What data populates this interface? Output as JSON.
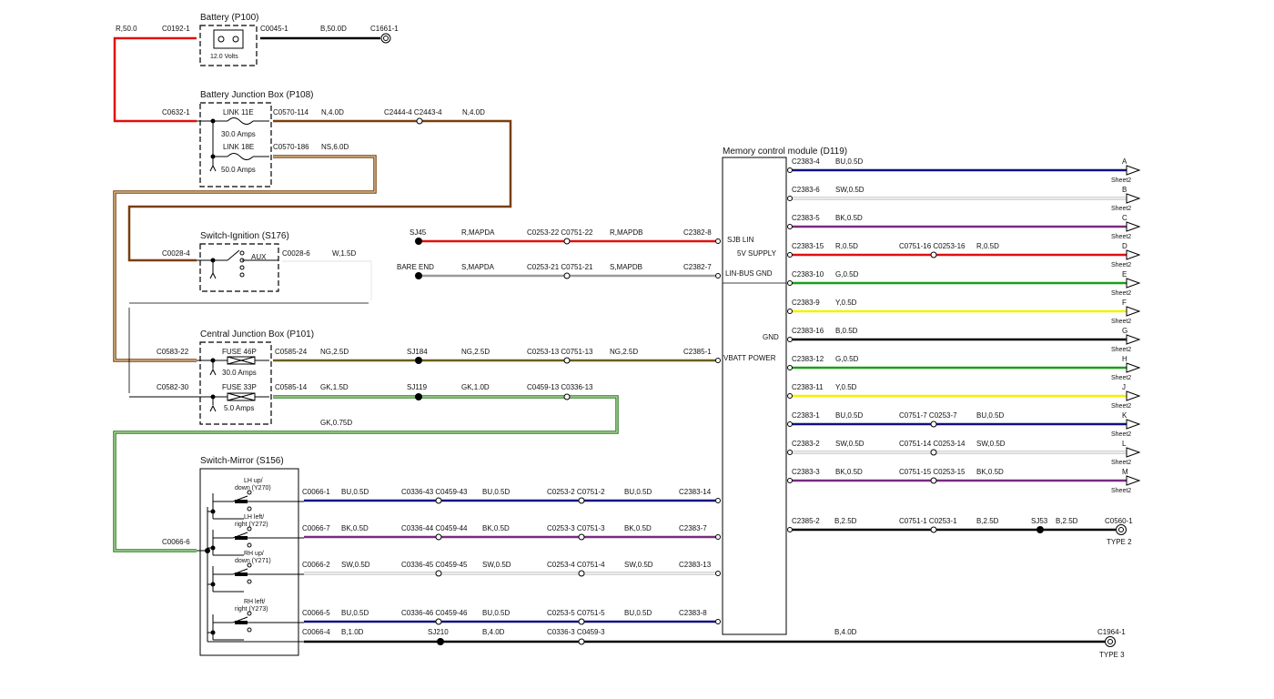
{
  "colors": {
    "red": "#e01010",
    "black": "#000000",
    "brown": "#7a3f0c",
    "blue": "#101080",
    "white": "#c4c4c4",
    "green": "#18a018",
    "yellow": "#f4f000",
    "olive": "#6a5f1a",
    "lightgreen": "#5cae46",
    "violet": "#7a2a80",
    "tan": "#c8a070",
    "grey": "#9a9a9a"
  },
  "battery": {
    "title": "Battery (P100)",
    "voltage": "12.0 Volts",
    "left_connector": "C0192-1",
    "left_wire": "R,50.0",
    "right_connector": "C0045-1",
    "right_wire": "B,50.0D",
    "ground": "C1661-1"
  },
  "bjb": {
    "title": "Battery Junction Box (P108)",
    "in_connector": "C0632-1",
    "link1_name": "LINK 11E",
    "link1_amps": "30.0 Amps",
    "link1_connector": "C0570-114",
    "link1_wire": "N,4.0D",
    "inline_connectors": "C2444-4 C2443-4",
    "inline_wire": "N,4.0D",
    "link2_name": "LINK 18E",
    "link2_amps": "50.0 Amps",
    "link2_connector": "C0570-186",
    "link2_wire": "NS,6.0D"
  },
  "ignition": {
    "title": "Switch-Ignition (S176)",
    "in_connector": "C0028-4",
    "pos_label": "AUX",
    "out_connector": "C0028-6",
    "out_wire": "W,1.5D"
  },
  "cjb": {
    "title": "Central Junction Box (P101)",
    "in1_connector": "C0583-22",
    "fuse1_name": "FUSE 46P",
    "fuse1_amps": "30.0 Amps",
    "out1_connector": "C0585-24",
    "out1_wire": "NG,2.5D",
    "in2_connector": "C0582-30",
    "fuse2_name": "FUSE 33P",
    "fuse2_amps": "5.0 Amps",
    "out2_connector": "C0585-14",
    "out2_wire": "GK,1.5D"
  },
  "middle": {
    "sj45": "SJ45",
    "sj45_wire": "R,MAPDA",
    "sj45_inline": "C0253-22 C0751-22",
    "sj45_wire2": "R,MAPDB",
    "sj45_end": "C2382-8",
    "bare_end": "BARE END",
    "bare_wire": "S,MAPDA",
    "bare_inline": "C0253-21 C0751-21",
    "bare_wire2": "S,MAPDB",
    "bare_end_conn": "C2382-7",
    "sj184": "SJ184",
    "sj184_wire": "NG,2.5D",
    "sj184_inline": "C0253-13 C0751-13",
    "sj184_wire2": "NG,2.5D",
    "sj184_end": "C2385-1",
    "sj119": "SJ119",
    "sj119_wire": "GK,1.0D",
    "sj119_inline": "C0459-13 C0336-13",
    "gk_return": "GK,0.75D"
  },
  "mirror": {
    "title": "Switch-Mirror (S156)",
    "in_connector": "C0066-6",
    "switches": [
      {
        "l1": "LH up/",
        "l2": "down (Y270)"
      },
      {
        "l1": "LH left/",
        "l2": "right (Y272)"
      },
      {
        "l1": "RH up/",
        "l2": "down (Y271)"
      },
      {
        "l1": "RH left/",
        "l2": "right (Y273)"
      }
    ],
    "wires": [
      {
        "c1": "C0066-1",
        "w1": "BU,0.5D",
        "c2": "C0336-43 C0459-43",
        "w2": "BU,0.5D",
        "c3": "C0253-2 C0751-2",
        "w3": "BU,0.5D",
        "end": "C2383-14"
      },
      {
        "c1": "C0066-7",
        "w1": "BK,0.5D",
        "c2": "C0336-44 C0459-44",
        "w2": "BK,0.5D",
        "c3": "C0253-3 C0751-3",
        "w3": "BK,0.5D",
        "end": "C2383-7"
      },
      {
        "c1": "C0066-2",
        "w1": "SW,0.5D",
        "c2": "C0336-45 C0459-45",
        "w2": "SW,0.5D",
        "c3": "C0253-4 C0751-4",
        "w3": "SW,0.5D",
        "end": "C2383-13"
      },
      {
        "c1": "C0066-5",
        "w1": "BU,0.5D",
        "c2": "C0336-46 C0459-46",
        "w2": "BU,0.5D",
        "c3": "C0253-5 C0751-5",
        "w3": "BU,0.5D",
        "end": "C2383-8"
      }
    ],
    "ground": {
      "c1": "C0066-4",
      "w1": "B,1.0D",
      "sj": "SJ210",
      "w2": "B,4.0D",
      "inline": "C0336-3 C0459-3",
      "w3": "B,4.0D",
      "end": "C1964-1",
      "type": "TYPE 3"
    }
  },
  "module": {
    "title": "Memory control module (D119)",
    "pins": [
      "SJB LIN",
      "5V SUPPLY",
      "LIN-BUS GND",
      "GND",
      "VBATT POWER"
    ]
  },
  "outputs": [
    {
      "conn": "C2383-4",
      "wire": "BU,0.5D",
      "inline": "",
      "wire2": "",
      "letter": "A",
      "sheet": "Sheet2"
    },
    {
      "conn": "C2383-6",
      "wire": "SW,0.5D",
      "inline": "",
      "wire2": "",
      "letter": "B",
      "sheet": "Sheet2"
    },
    {
      "conn": "C2383-5",
      "wire": "BK,0.5D",
      "inline": "",
      "wire2": "",
      "letter": "C",
      "sheet": "Sheet2"
    },
    {
      "conn": "C2383-15",
      "wire": "R,0.5D",
      "inline": "C0751-16 C0253-16",
      "wire2": "R,0.5D",
      "letter": "D",
      "sheet": "Sheet2"
    },
    {
      "conn": "C2383-10",
      "wire": "G,0.5D",
      "inline": "",
      "wire2": "",
      "letter": "E",
      "sheet": "Sheet2"
    },
    {
      "conn": "C2383-9",
      "wire": "Y,0.5D",
      "inline": "",
      "wire2": "",
      "letter": "F",
      "sheet": "Sheet2"
    },
    {
      "conn": "C2383-16",
      "wire": "B,0.5D",
      "inline": "",
      "wire2": "",
      "letter": "G",
      "sheet": "Sheet2"
    },
    {
      "conn": "C2383-12",
      "wire": "G,0.5D",
      "inline": "",
      "wire2": "",
      "letter": "H",
      "sheet": "Sheet2"
    },
    {
      "conn": "C2383-11",
      "wire": "Y,0.5D",
      "inline": "",
      "wire2": "",
      "letter": "J",
      "sheet": "Sheet2"
    },
    {
      "conn": "C2383-1",
      "wire": "BU,0.5D",
      "inline": "C0751-7 C0253-7",
      "wire2": "BU,0.5D",
      "letter": "K",
      "sheet": "Sheet2"
    },
    {
      "conn": "C2383-2",
      "wire": "SW,0.5D",
      "inline": "C0751-14 C0253-14",
      "wire2": "SW,0.5D",
      "letter": "L",
      "sheet": "Sheet2"
    },
    {
      "conn": "C2383-3",
      "wire": "BK,0.5D",
      "inline": "C0751-15 C0253-15",
      "wire2": "BK,0.5D",
      "letter": "M",
      "sheet": "Sheet2"
    }
  ],
  "ground_out": {
    "conn": "C2385-2",
    "wire": "B,2.5D",
    "inline": "C0751-1 C0253-1",
    "wire2": "B,2.5D",
    "sj": "SJ53",
    "wire3": "B,2.5D",
    "end": "C0560-1",
    "type": "TYPE 2"
  }
}
